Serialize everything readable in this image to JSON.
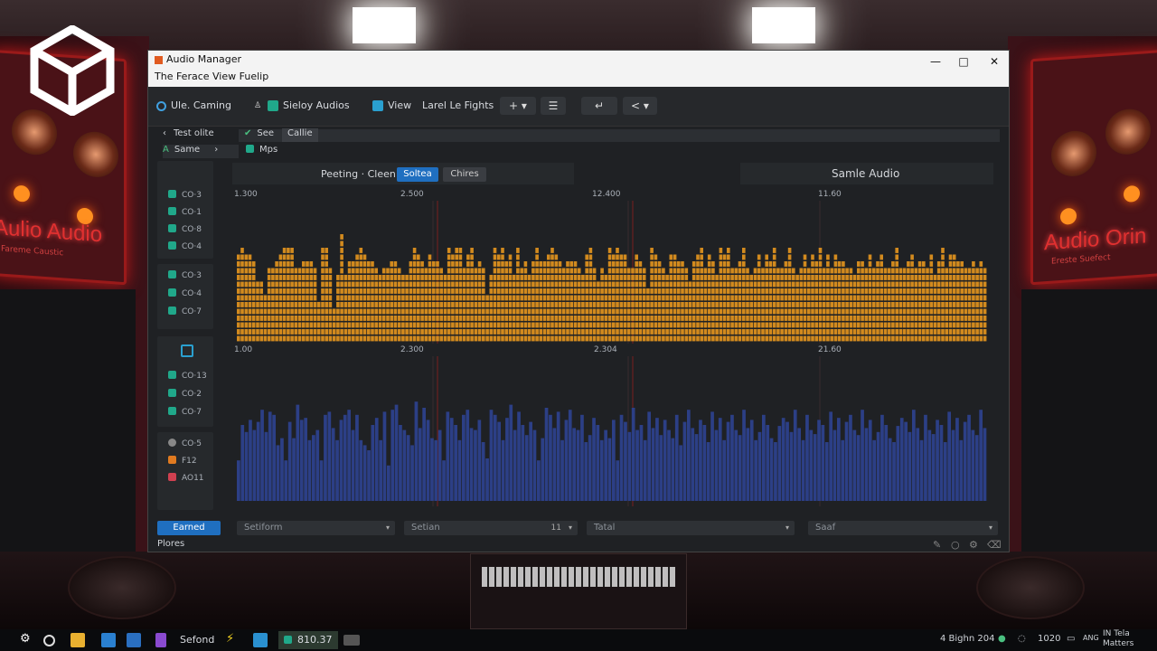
{
  "background": {
    "left_panel_title": "Aulio Audio",
    "left_panel_subtitle": "Fareme Caustic",
    "right_panel_title": "Audio Orin",
    "right_panel_subtitle": "Ereste Suefect"
  },
  "window": {
    "title": "Audio Manager",
    "subtitle": "The Ferace View Fuelip",
    "controls": {
      "minimize": "—",
      "maximize": "□",
      "close": "✕"
    }
  },
  "toolbar": {
    "search_label": "Ule. Caming",
    "audios_label": "Sieloy Audios",
    "view_label": "View",
    "lights_label": "Larel Le Fights",
    "add_button": "+ ▾",
    "list_button": "☰",
    "return_button": "↵",
    "back_button": "< ▾"
  },
  "nav": {
    "row1_left": "Test olite",
    "row1_right_a": "See",
    "row1_right_b": "Callie",
    "row2_left": "Same",
    "row2_right": "Mps"
  },
  "header": {
    "left_text": "Peeting · Cleen",
    "chip_active": "Soltea",
    "chip_inactive": "Chires",
    "right_title": "Samle Audio"
  },
  "tracks": {
    "group1": [
      "CO·3",
      "CO·1",
      "CO·8",
      "CO·4"
    ],
    "group2": [
      "CO·3",
      "CO·4",
      "CO·7"
    ],
    "group3": [
      "CO·13",
      "CO·2",
      "CO·7"
    ],
    "group4": [
      "CO·5",
      "F12",
      "AO11"
    ]
  },
  "top_axis_labels": [
    "1.300",
    "2.500",
    "12.400",
    "11.60"
  ],
  "bottom_axis_labels": [
    "1.00",
    "2.300",
    "2.304",
    "21.60"
  ],
  "chart_data": [
    {
      "type": "bar",
      "series": [
        {
          "values": [
            13,
            14,
            13,
            13,
            12,
            9,
            9,
            7,
            11,
            11,
            12,
            13,
            14,
            14,
            14,
            11,
            11,
            12,
            12,
            12,
            11,
            6,
            14,
            14,
            11,
            5,
            10,
            16,
            10,
            12,
            12,
            13,
            14,
            13,
            12,
            12,
            11,
            10,
            11,
            11,
            12,
            12,
            11,
            10,
            10,
            12,
            14,
            13,
            12,
            11,
            13,
            12,
            12,
            11,
            10,
            14,
            13,
            14,
            14,
            11,
            13,
            14,
            11,
            12,
            11,
            7,
            10,
            14,
            13,
            14,
            12,
            13,
            10,
            14,
            11,
            12,
            10,
            12,
            14,
            12,
            12,
            13,
            14,
            13,
            12,
            11,
            12,
            12,
            12,
            11,
            10,
            13,
            14,
            11,
            9,
            11,
            10,
            14,
            13,
            14,
            13,
            13,
            11,
            11,
            13,
            12,
            11,
            8,
            14,
            13,
            12,
            11,
            10,
            13,
            13,
            12,
            12,
            11,
            9,
            12,
            13,
            14,
            11,
            13,
            12,
            10,
            14,
            13,
            14,
            11,
            11,
            12,
            14,
            11,
            10,
            11,
            13,
            11,
            13,
            12,
            14,
            11,
            11,
            12,
            14,
            11,
            10,
            11,
            13,
            11,
            13,
            12,
            14,
            11,
            13,
            11,
            13,
            12,
            12,
            11,
            11,
            10,
            12,
            12,
            11,
            13,
            11,
            12,
            13,
            11,
            11,
            12,
            14,
            11,
            11,
            12,
            13,
            11,
            12,
            12,
            11,
            13,
            10,
            12,
            14,
            11,
            13,
            13,
            12,
            12,
            11,
            11,
            12,
            11,
            12,
            11
          ]
        }
      ],
      "color": "#d28a1e"
    },
    {
      "type": "bar",
      "series": [
        {
          "values": [
            0.4,
            0.75,
            0.68,
            0.8,
            0.7,
            0.78,
            0.9,
            0.68,
            0.88,
            0.85,
            0.55,
            0.62,
            0.4,
            0.78,
            0.62,
            0.95,
            0.8,
            0.82,
            0.6,
            0.65,
            0.7,
            0.4,
            0.85,
            0.88,
            0.72,
            0.6,
            0.8,
            0.85,
            0.9,
            0.7,
            0.85,
            0.6,
            0.55,
            0.5,
            0.75,
            0.82,
            0.6,
            0.88,
            0.35,
            0.9,
            0.95,
            0.75,
            0.7,
            0.65,
            0.55,
            0.98,
            0.72,
            0.92,
            0.8,
            0.62,
            0.6,
            0.7,
            0.4,
            0.88,
            0.82,
            0.75,
            0.6,
            0.85,
            0.9,
            0.72,
            0.7,
            0.8,
            0.58,
            0.42,
            0.9,
            0.85,
            0.78,
            0.6,
            0.82,
            0.95,
            0.7,
            0.88,
            0.75,
            0.65,
            0.78,
            0.7,
            0.4,
            0.62,
            0.92,
            0.85,
            0.72,
            0.88,
            0.6,
            0.8,
            0.9,
            0.72,
            0.7,
            0.85,
            0.58,
            0.65,
            0.82,
            0.75,
            0.6,
            0.7,
            0.62,
            0.8,
            0.4,
            0.85,
            0.78,
            0.68,
            0.92,
            0.7,
            0.75,
            0.6,
            0.88,
            0.72,
            0.82,
            0.65,
            0.8,
            0.7,
            0.62,
            0.85,
            0.55,
            0.78,
            0.9,
            0.72,
            0.66,
            0.8,
            0.75,
            0.58,
            0.88,
            0.7,
            0.82,
            0.6,
            0.78,
            0.85,
            0.7,
            0.65,
            0.9,
            0.72,
            0.8,
            0.6,
            0.68,
            0.85,
            0.75,
            0.62,
            0.58,
            0.74,
            0.82,
            0.78,
            0.68,
            0.9,
            0.72,
            0.6,
            0.85,
            0.7,
            0.66,
            0.8,
            0.75,
            0.58,
            0.88,
            0.7,
            0.82,
            0.6,
            0.78,
            0.85,
            0.7,
            0.65,
            0.9,
            0.72,
            0.8,
            0.6,
            0.68,
            0.85,
            0.75,
            0.62,
            0.58,
            0.74,
            0.82,
            0.78,
            0.68,
            0.9,
            0.72,
            0.6,
            0.85,
            0.7,
            0.66,
            0.8,
            0.75,
            0.58,
            0.88,
            0.7,
            0.82,
            0.6,
            0.78,
            0.85,
            0.7,
            0.65,
            0.9,
            0.72
          ]
        }
      ],
      "color": "#2c3f86"
    }
  ],
  "bottom_bar": {
    "primary_button": "Earned",
    "select1": "Setiform",
    "select2": "Setian",
    "select2_value": "11",
    "select3": "Tatal",
    "select4": "Saaf"
  },
  "status": {
    "left_text": "Plores"
  },
  "taskbar": {
    "app_label": "Sefond",
    "active_app_label": "810.37",
    "tray_text": "4 Bighn 204",
    "tray_time": "1020",
    "tray_lang": "ANG",
    "tray_notif_top": "IN Tela",
    "tray_notif_bottom": "Matters"
  }
}
